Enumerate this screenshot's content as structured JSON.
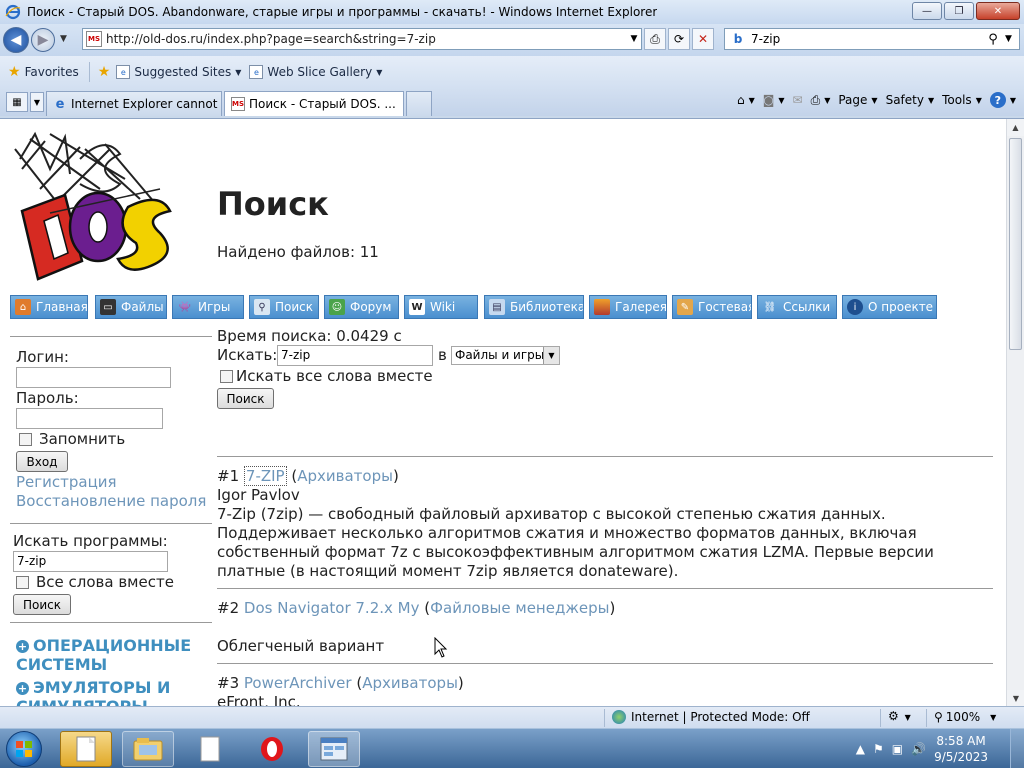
{
  "window": {
    "title": "Поиск - Старый DOS. Abandonware, старые игры и программы - скачать! - Windows Internet Explorer",
    "minimize": "—",
    "maximize": "❐",
    "close": "✕"
  },
  "address": {
    "url": "http://old-dos.ru/index.php?page=search&string=7-zip",
    "search_query": "7-zip",
    "search_engine_icon": "bing-icon"
  },
  "favorites_bar": {
    "favorites": "Favorites",
    "suggested_sites": "Suggested Sites",
    "web_slice_gallery": "Web Slice Gallery"
  },
  "tabs": [
    {
      "label": "Internet Explorer cannot di..."
    },
    {
      "label": "Поиск - Старый DOS. ...",
      "close": "✕"
    },
    {
      "label": ""
    }
  ],
  "command_bar": {
    "page": "Page",
    "safety": "Safety",
    "tools": "Tools",
    "help": "?"
  },
  "page": {
    "title": "Поиск",
    "found": "Найдено файлов: 11",
    "logo_text": "MS DOS",
    "menu": [
      {
        "label": "Главная",
        "icon": "home-icon",
        "color": "#e07b2c"
      },
      {
        "label": "Файлы",
        "icon": "computer-icon",
        "color": "#333333"
      },
      {
        "label": "Игры",
        "icon": "invader-icon",
        "color": "#3c3c3c"
      },
      {
        "label": "Поиск",
        "icon": "magnifier-icon",
        "color": "#d9e6f2"
      },
      {
        "label": "Форум",
        "icon": "user-icon",
        "color": "#4aa34a"
      },
      {
        "label": "Wiki",
        "icon": "wiki-icon",
        "color": "#ffffff"
      },
      {
        "label": "Библиотека",
        "icon": "book-icon",
        "color": "#c6d9ef"
      },
      {
        "label": "Галерея",
        "icon": "picture-icon",
        "color": "#b33a2e"
      },
      {
        "label": "Гостевая",
        "icon": "guestbook-icon",
        "color": "#e3a64b"
      },
      {
        "label": "Ссылки",
        "icon": "chain-icon",
        "color": "#d4dde6"
      },
      {
        "label": "О проекте",
        "icon": "info-icon",
        "color": "#1e4f8f"
      }
    ],
    "login": {
      "login_label": "Логин:",
      "password_label": "Пароль:",
      "remember_label": "Запомнить",
      "submit": "Вход",
      "register": "Регистрация",
      "recover": "Восстановление пароля"
    },
    "side_search": {
      "label": "Искать программы:",
      "value": "7-zip",
      "all_words": "Все слова вместе",
      "submit": "Поиск"
    },
    "categories": [
      {
        "label": "ОПЕРАЦИОННЫЕ СИСТЕМЫ"
      },
      {
        "label": "ЭМУЛЯТОРЫ И СИМУЛЯТОРЫ"
      }
    ],
    "search_form": {
      "time": "Время поиска: 0.0429 с",
      "search_label": "Искать:",
      "search_value": "7-zip",
      "in_label": "в",
      "scope": "Файлы и игры",
      "all_words": "Искать все слова вместе",
      "submit": "Поиск"
    },
    "results": [
      {
        "num": "#1",
        "name": "7-ZIP",
        "category": "Архиваторы",
        "author": "Igor Pavlov",
        "description": "7-Zip (7zip) — свободный файловый архиватор с высокой степенью сжатия данных. Поддерживает несколько алгоритмов сжатия и множество форматов данных, включая собственный формат 7z с высокоэффективным алгоритмом сжатия LZMA. Первые версии платные (в настоящий момент 7zip является donateware)."
      },
      {
        "num": "#2",
        "name": "Dos Navigator 7.2.x My",
        "category": "Файловые менеджеры",
        "description": "Облегченый вариант"
      },
      {
        "num": "#3",
        "name": "PowerArchiver",
        "category": "Архиваторы",
        "author": "eFront, Inc."
      }
    ]
  },
  "status_bar": {
    "zone": "Internet | Protected Mode: Off",
    "zoom": "100%"
  },
  "taskbar": {
    "time": "8:58 AM",
    "date": "9/5/2023"
  }
}
